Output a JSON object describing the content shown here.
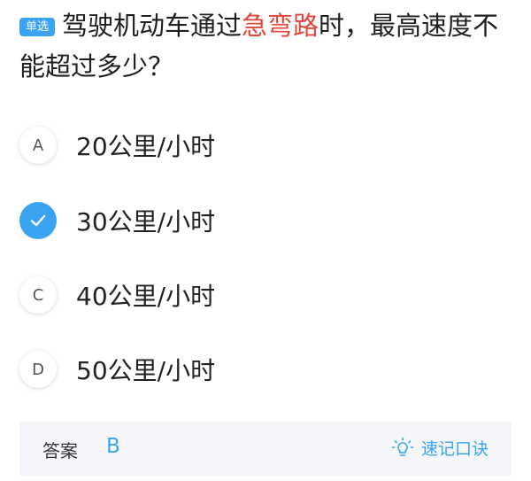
{
  "question": {
    "type_badge": "单选",
    "text_before": "驾驶机动车通过",
    "text_highlight": "急弯路",
    "text_after": "时，最高速度不能超过多少？",
    "highlight_color": "#e2463a"
  },
  "options": [
    {
      "key": "A",
      "text": "20公里/小时",
      "selected": false
    },
    {
      "key": "B",
      "text": "30公里/小时",
      "selected": true
    },
    {
      "key": "C",
      "text": "40公里/小时",
      "selected": false
    },
    {
      "key": "D",
      "text": "50公里/小时",
      "selected": false
    }
  ],
  "answer": {
    "label": "答案",
    "value": "B"
  },
  "tips_button": {
    "icon": "lightbulb-icon",
    "label": "速记口诀"
  },
  "colors": {
    "accent": "#3aa4f2",
    "answer_bar_bg": "#f4f6f9"
  }
}
